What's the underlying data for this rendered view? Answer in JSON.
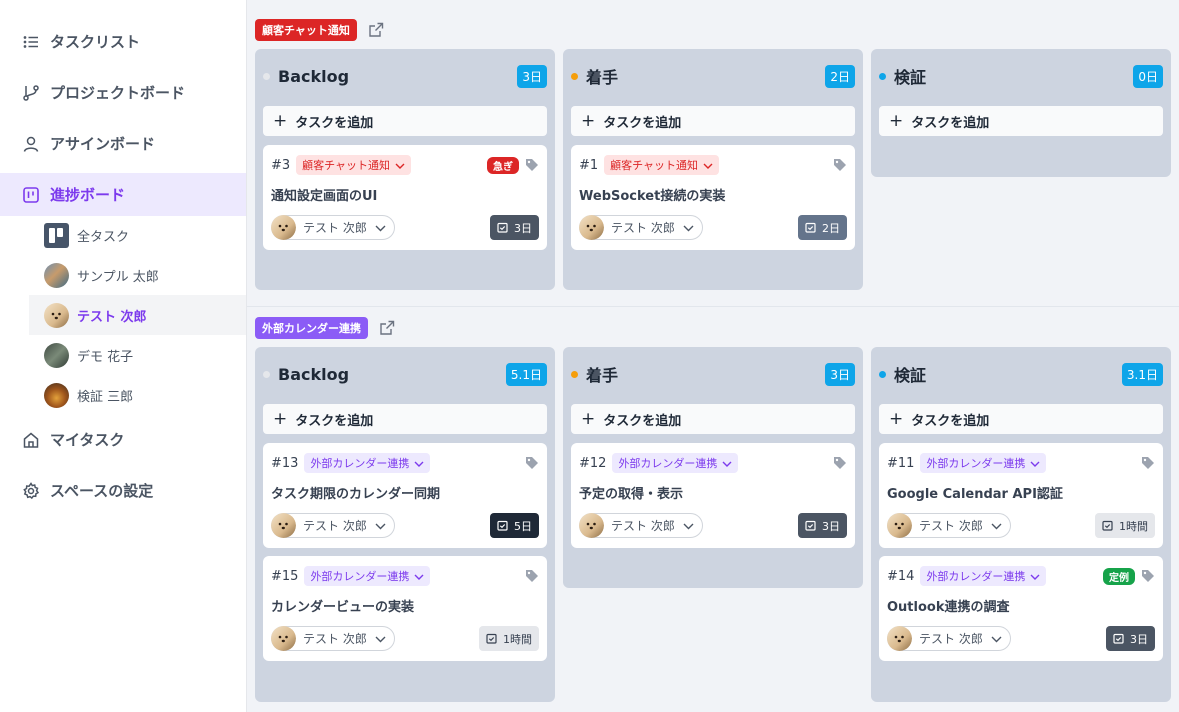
{
  "sidebar": {
    "nav": [
      {
        "label": "タスクリスト"
      },
      {
        "label": "プロジェクトボード"
      },
      {
        "label": "アサインボード"
      },
      {
        "label": "進捗ボード"
      },
      {
        "label": "マイタスク"
      },
      {
        "label": "スペースの設定"
      }
    ],
    "members": [
      {
        "label": "全タスク"
      },
      {
        "label": "サンプル 太郎"
      },
      {
        "label": "テスト 次郎"
      },
      {
        "label": "デモ 花子"
      },
      {
        "label": "検証 三郎"
      }
    ]
  },
  "projects": [
    {
      "tag": "顧客チャット通知",
      "color": "#dc2626",
      "columns": [
        {
          "title": "Backlog",
          "badge": "3日",
          "dot": "#e5e7eb",
          "add_label": "タスクを追加",
          "cards": [
            {
              "num": "#3",
              "project": "顧客チャット通知",
              "urgent": "急ぎ",
              "title": "通知設定画面のUI",
              "assignee": "テスト 次郎",
              "due": "3日"
            }
          ]
        },
        {
          "title": "着手",
          "badge": "2日",
          "dot": "#f59e0b",
          "add_label": "タスクを追加",
          "cards": [
            {
              "num": "#1",
              "project": "顧客チャット通知",
              "title": "WebSocket接続の実装",
              "assignee": "テスト 次郎",
              "due": "2日"
            }
          ]
        },
        {
          "title": "検証",
          "badge": "0日",
          "dot": "#0ea5e9",
          "add_label": "タスクを追加",
          "cards": []
        }
      ]
    },
    {
      "tag": "外部カレンダー連携",
      "color": "#8b5cf6",
      "columns": [
        {
          "title": "Backlog",
          "badge": "5.1日",
          "dot": "#e5e7eb",
          "add_label": "タスクを追加",
          "cards": [
            {
              "num": "#13",
              "project": "外部カレンダー連携",
              "title": "タスク期限のカレンダー同期",
              "assignee": "テスト 次郎",
              "due": "5日"
            },
            {
              "num": "#15",
              "project": "外部カレンダー連携",
              "title": "カレンダービューの実装",
              "assignee": "テスト 次郎",
              "due": "1時間"
            }
          ]
        },
        {
          "title": "着手",
          "badge": "3日",
          "dot": "#f59e0b",
          "add_label": "タスクを追加",
          "cards": [
            {
              "num": "#12",
              "project": "外部カレンダー連携",
              "title": "予定の取得・表示",
              "assignee": "テスト 次郎",
              "due": "3日"
            }
          ]
        },
        {
          "title": "検証",
          "badge": "3.1日",
          "dot": "#0ea5e9",
          "add_label": "タスクを追加",
          "cards": [
            {
              "num": "#11",
              "project": "外部カレンダー連携",
              "title": "Google Calendar API認証",
              "assignee": "テスト 次郎",
              "due": "1時間"
            },
            {
              "num": "#14",
              "project": "外部カレンダー連携",
              "regular": "定例",
              "title": "Outlook連携の調査",
              "assignee": "テスト 次郎",
              "due": "3日"
            }
          ]
        }
      ]
    }
  ]
}
